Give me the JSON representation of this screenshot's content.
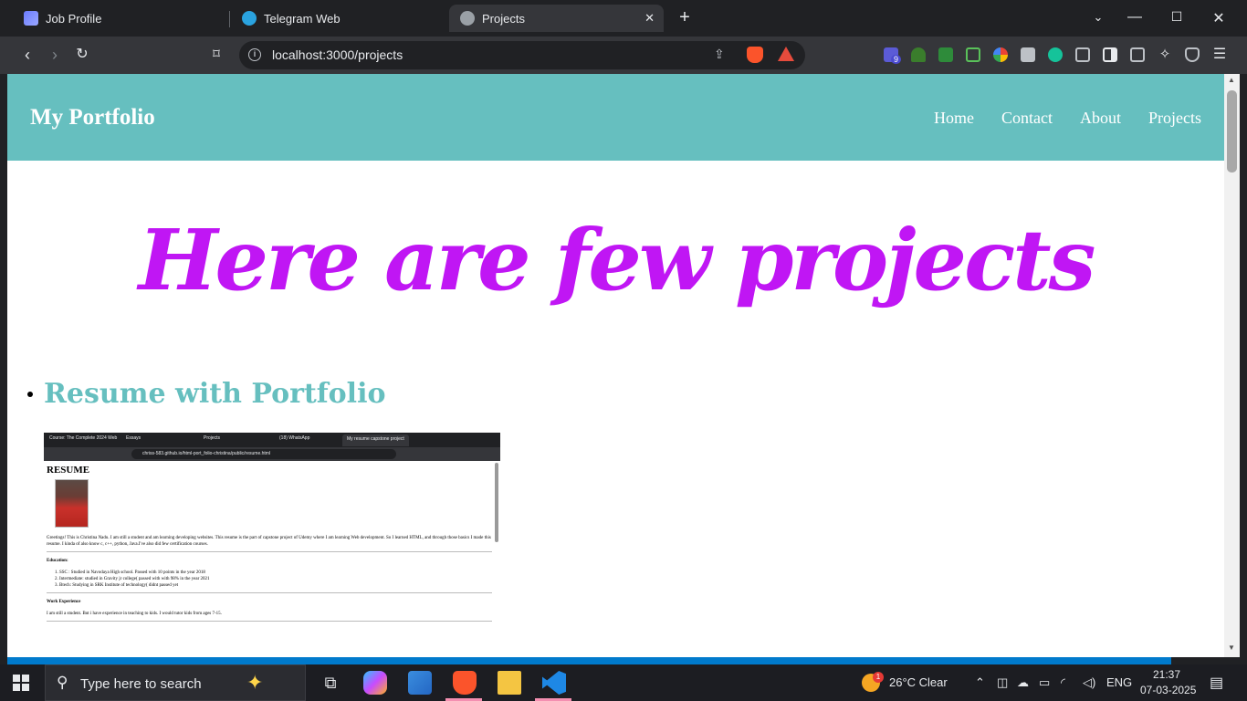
{
  "browser": {
    "tabs": [
      {
        "title": "Job Profile",
        "active": false
      },
      {
        "title": "Telegram Web",
        "active": false
      },
      {
        "title": "Projects",
        "active": true
      }
    ],
    "new_tab_glyph": "+",
    "address": "localhost:3000/projects",
    "extension_badge": "9"
  },
  "page": {
    "brand": "My Portfolio",
    "nav": [
      "Home",
      "Contact",
      "About",
      "Projects"
    ],
    "heading": "Here are few projects",
    "projects": [
      {
        "title": "Resume with Portfolio"
      }
    ],
    "colors": {
      "navbar": "#66bfbf",
      "heading": "#c016f4",
      "project_title": "#66bfbf"
    }
  },
  "thumbnail": {
    "tabs": [
      "Course: The Complete 2024 Web",
      "Essays",
      "Projects",
      "(18) WhatsApp",
      "My resume capstone project"
    ],
    "address": "chriss-583.github.io/html-port_folio-christina/public/resume.html",
    "heading": "RESUME",
    "intro": "Greetings! This is Christina Nadu. I am still a student and am learning developing websites. This resume is the part of capstone project of Udemy where I am learning Web development. So I learned HTML, and through those basics I made this resume. I kinda of also know c, c++, python, Java.I've also did few certification courses.",
    "education_heading": "Education:",
    "education": [
      "SSC : Studied in Navodaya High school. Passed with 10 points in the year 2018",
      "Intermediate: studied in Gravity jr college( passed with with 98% in the year 2021",
      "Btech: Studying in SRK Institute of technology( didnt passed yet"
    ],
    "work_heading": "Work Experience",
    "work": "I am still a student. But i have experience in teaching to kids. I would tutor kids from ages 7-15."
  },
  "taskbar": {
    "search_placeholder": "Type here to search",
    "weather": "26°C  Clear",
    "lang": "ENG",
    "time": "21:37",
    "date": "07-03-2025",
    "notification_count": "1"
  }
}
